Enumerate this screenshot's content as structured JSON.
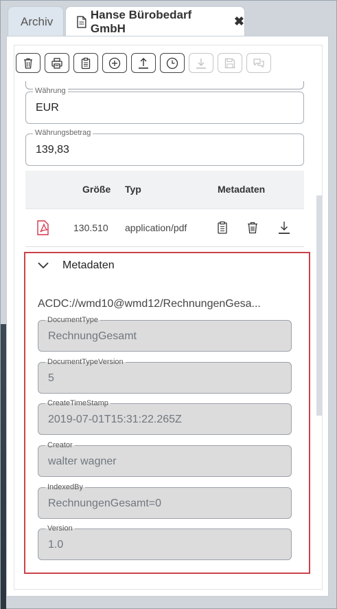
{
  "tabs": {
    "archive_label": "Archiv",
    "active_label": "Hanse Bürobedarf GmbH",
    "close_glyph": "✖"
  },
  "toolbar": {
    "buttons": [
      {
        "icon": "trash-icon",
        "enabled": true
      },
      {
        "icon": "print-icon",
        "enabled": true
      },
      {
        "icon": "clipboard-icon",
        "enabled": true
      },
      {
        "icon": "plus-circle-icon",
        "enabled": true
      },
      {
        "icon": "upload-icon",
        "enabled": true
      },
      {
        "icon": "clock-icon",
        "enabled": true
      },
      {
        "icon": "download-icon",
        "enabled": false
      },
      {
        "icon": "save-icon",
        "enabled": false
      },
      {
        "icon": "comments-icon",
        "enabled": false
      }
    ]
  },
  "form": {
    "currency": {
      "label": "Währung",
      "value": "EUR"
    },
    "currency_amount": {
      "label": "Währungsbetrag",
      "value": "139,83"
    }
  },
  "attachments_table": {
    "headers": {
      "size": "Größe",
      "type": "Typ",
      "metadata": "Metadaten"
    },
    "rows": [
      {
        "file_icon": "pdf-icon",
        "size": "130.510",
        "type": "application/pdf"
      }
    ]
  },
  "metadata_panel": {
    "title": "Metadaten",
    "path": "ACDC://wmd10@wmd12/RechnungenGesa...",
    "fields": [
      {
        "label": "DocumentType",
        "value": "RechnungGesamt"
      },
      {
        "label": "DocumentTypeVersion",
        "value": "5"
      },
      {
        "label": "CreateTimeStamp",
        "value": "2019-07-01T15:31:22.265Z"
      },
      {
        "label": "Creator",
        "value": "walter wagner"
      },
      {
        "label": "IndexedBy",
        "value": "RechnungenGesamt=0"
      },
      {
        "label": "Version",
        "value": "1.0"
      }
    ]
  },
  "colors": {
    "highlight_border": "#c9424a",
    "pdf_red": "#d6334a"
  }
}
